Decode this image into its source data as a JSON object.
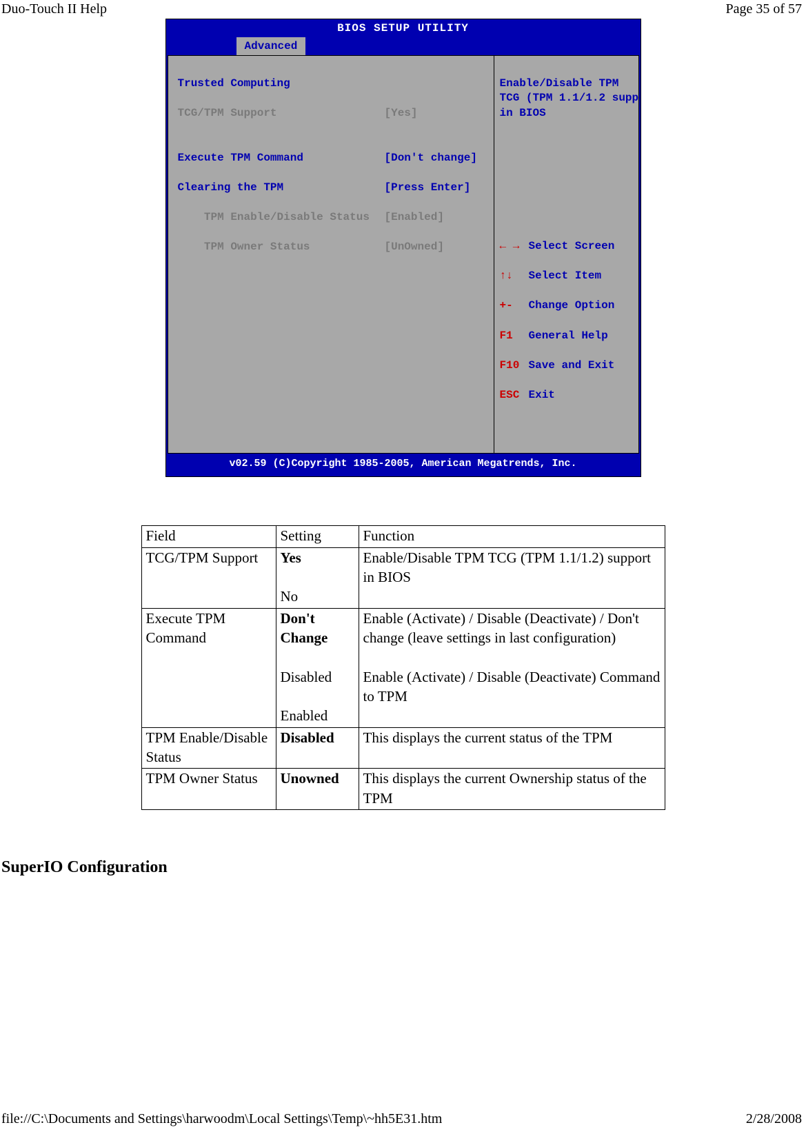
{
  "header": {
    "left": "Duo-Touch II Help",
    "right": "Page 35 of 57"
  },
  "bios": {
    "titlebar": "BIOS SETUP UTILITY",
    "activeTab": "Advanced",
    "left": {
      "heading": "Trusted Computing",
      "row1": {
        "label": "TCG/TPM Support",
        "value": "[Yes]"
      },
      "row2": {
        "label": "Execute TPM Command",
        "value": "[Don't change]"
      },
      "row3": {
        "label": "Clearing the TPM",
        "value": "[Press Enter]"
      },
      "row4": {
        "label": "    TPM Enable/Disable Status",
        "value": "[Enabled]"
      },
      "row5": {
        "label": "    TPM Owner Status",
        "value": "[UnOwned]"
      }
    },
    "right": {
      "line1": "Enable/Disable TPM",
      "line2": "TCG (TPM 1.1/1.2 supp",
      "line3": "in BIOS",
      "keys": {
        "k1": {
          "key": "← →",
          "desc": "Select Screen"
        },
        "k2": {
          "key": "↑↓",
          "desc": "Select Item"
        },
        "k3": {
          "key": "+-",
          "desc": "Change Option"
        },
        "k4": {
          "key": "F1",
          "desc": "General Help"
        },
        "k5": {
          "key": "F10",
          "desc": "Save and Exit"
        },
        "k6": {
          "key": "ESC",
          "desc": "Exit"
        }
      }
    },
    "footer": "v02.59 (C)Copyright 1985-2005, American Megatrends, Inc."
  },
  "table": {
    "headers": {
      "c1": "Field",
      "c2": "Setting",
      "c3": "Function"
    },
    "rows": [
      {
        "field": "TCG/TPM Support",
        "setting_bold": "Yes",
        "setting_rest": "No",
        "function": "Enable/Disable TPM TCG (TPM 1.1/1.2) support in BIOS"
      },
      {
        "field": "Execute TPM Command",
        "setting_bold": "Don't Change",
        "setting_rest2a": "Disabled",
        "setting_rest2b": "Enabled",
        "function_a": "Enable (Activate) / Disable (Deactivate) / Don't change (leave settings in last configuration)",
        "function_b": "Enable (Activate) / Disable (Deactivate) Command to TPM"
      },
      {
        "field": "TPM Enable/Disable Status",
        "setting_bold": "Disabled",
        "function": "This displays the current status of the TPM"
      },
      {
        "field": "TPM Owner Status",
        "setting_bold": "Unowned",
        "function": "This displays the current Ownership status of the TPM"
      }
    ]
  },
  "section_heading": "SuperIO Configuration",
  "footer": {
    "left": "file://C:\\Documents and Settings\\harwoodm\\Local Settings\\Temp\\~hh5E31.htm",
    "right": "2/28/2008"
  }
}
